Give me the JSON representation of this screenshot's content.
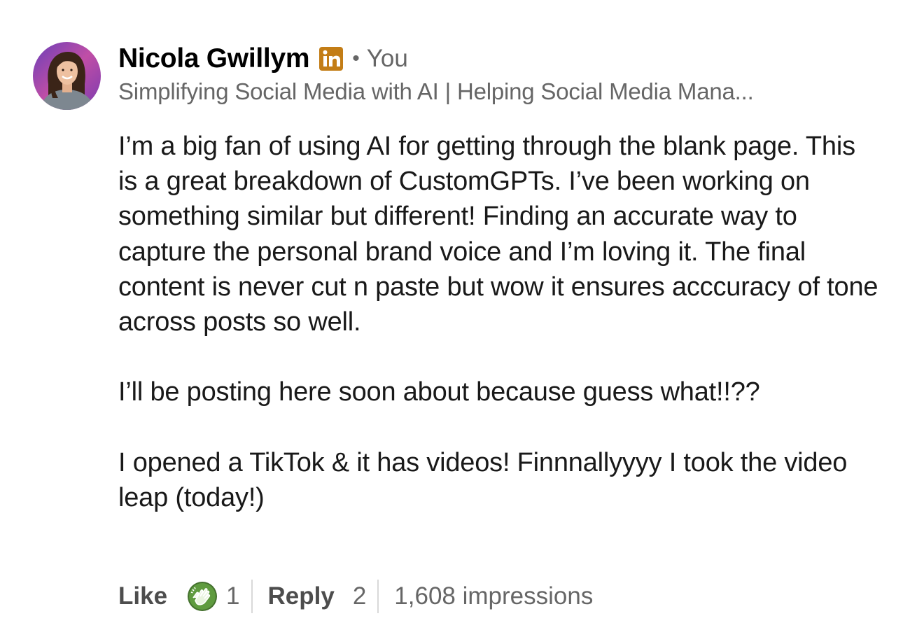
{
  "comment": {
    "author": {
      "name": "Nicola Gwillym",
      "badge_icon": "linkedin-premium-icon",
      "relation": "You",
      "headline": "Simplifying Social Media with AI | Helping Social Media Mana..."
    },
    "body": {
      "paragraphs": [
        "I’m a big fan of using AI for getting through the blank page. This is a great breakdown of CustomGPTs. I’ve been working on something similar but different! Finding an accurate way to capture the personal brand voice and I’m loving it. The final content is never cut n paste but wow it ensures acccuracy of tone across posts so well.",
        "I’ll be posting here soon about because guess what!!??",
        "I opened a TikTok & it has videos! Finnnallyyyy I took the video leap (today!)"
      ]
    },
    "actions": {
      "like_label": "Like",
      "reaction_icon": "celebrate-clap-icon",
      "reaction_count": "1",
      "reply_label": "Reply",
      "reply_count": "2",
      "impressions": "1,608 impressions"
    }
  },
  "colors": {
    "primary_text": "#191919",
    "secondary_text": "#666666",
    "linkedin_badge": "#c37d16",
    "celebrate_green": "#44712e",
    "separator": "#d9d9d9"
  }
}
